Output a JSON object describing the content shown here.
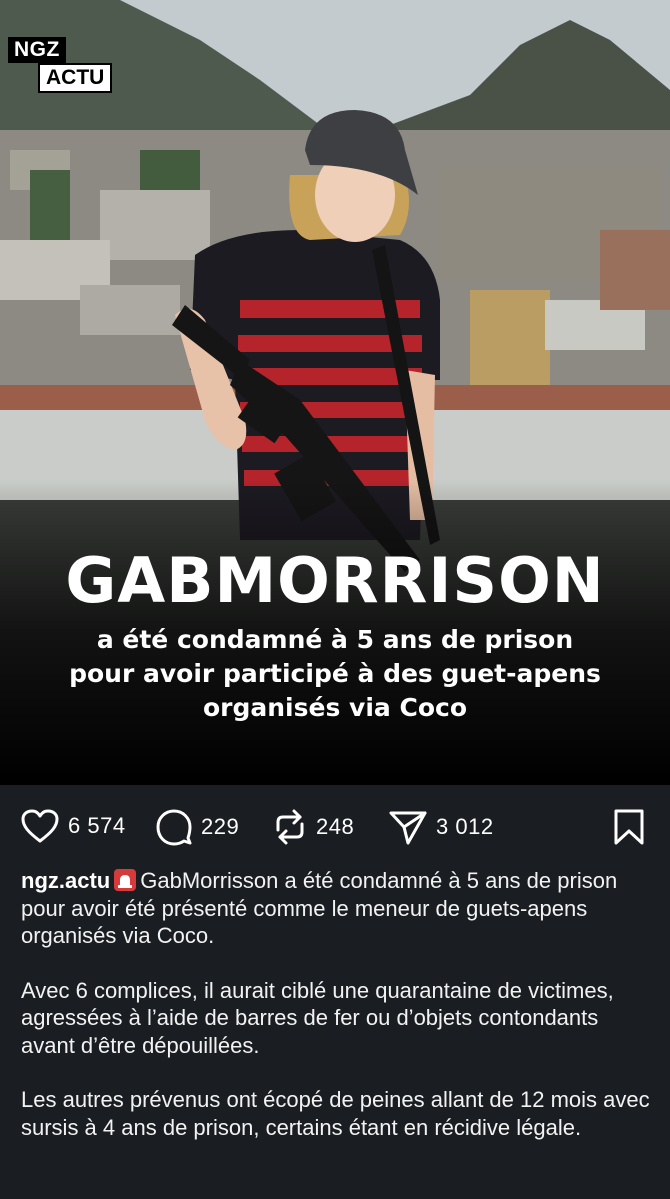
{
  "logo": {
    "line1": "NGZ",
    "line2": "ACTU"
  },
  "headline": {
    "title": "GABMORRISON",
    "subtitle_lines": [
      "a été condamné à 5 ans de prison",
      "pour avoir participé à des guet-apens",
      "organisés via Coco"
    ]
  },
  "actions": {
    "likes": "6 574",
    "comments": "229",
    "reposts": "248",
    "shares": "3 012"
  },
  "caption": {
    "username": "ngz.actu",
    "emoji": "siren-icon",
    "paragraph1": "GabMorrisson a été condamné à 5 ans de prison pour avoir été présenté comme le meneur de guets-apens organisés via Coco.",
    "paragraph2": "Avec 6 complices, il aurait ciblé une quarantaine de victimes, agressées à l’aide de barres de fer ou d’objets contondants avant d’être dépouillées.",
    "paragraph3": "Les autres prévenus ont écopé de peines allant de 12 mois avec sursis à 4 ans de prison, certains étant en récidive légale."
  },
  "colors": {
    "background": "#1a1d22",
    "text": "#ffffff",
    "shirt_red": "#b5232b"
  }
}
